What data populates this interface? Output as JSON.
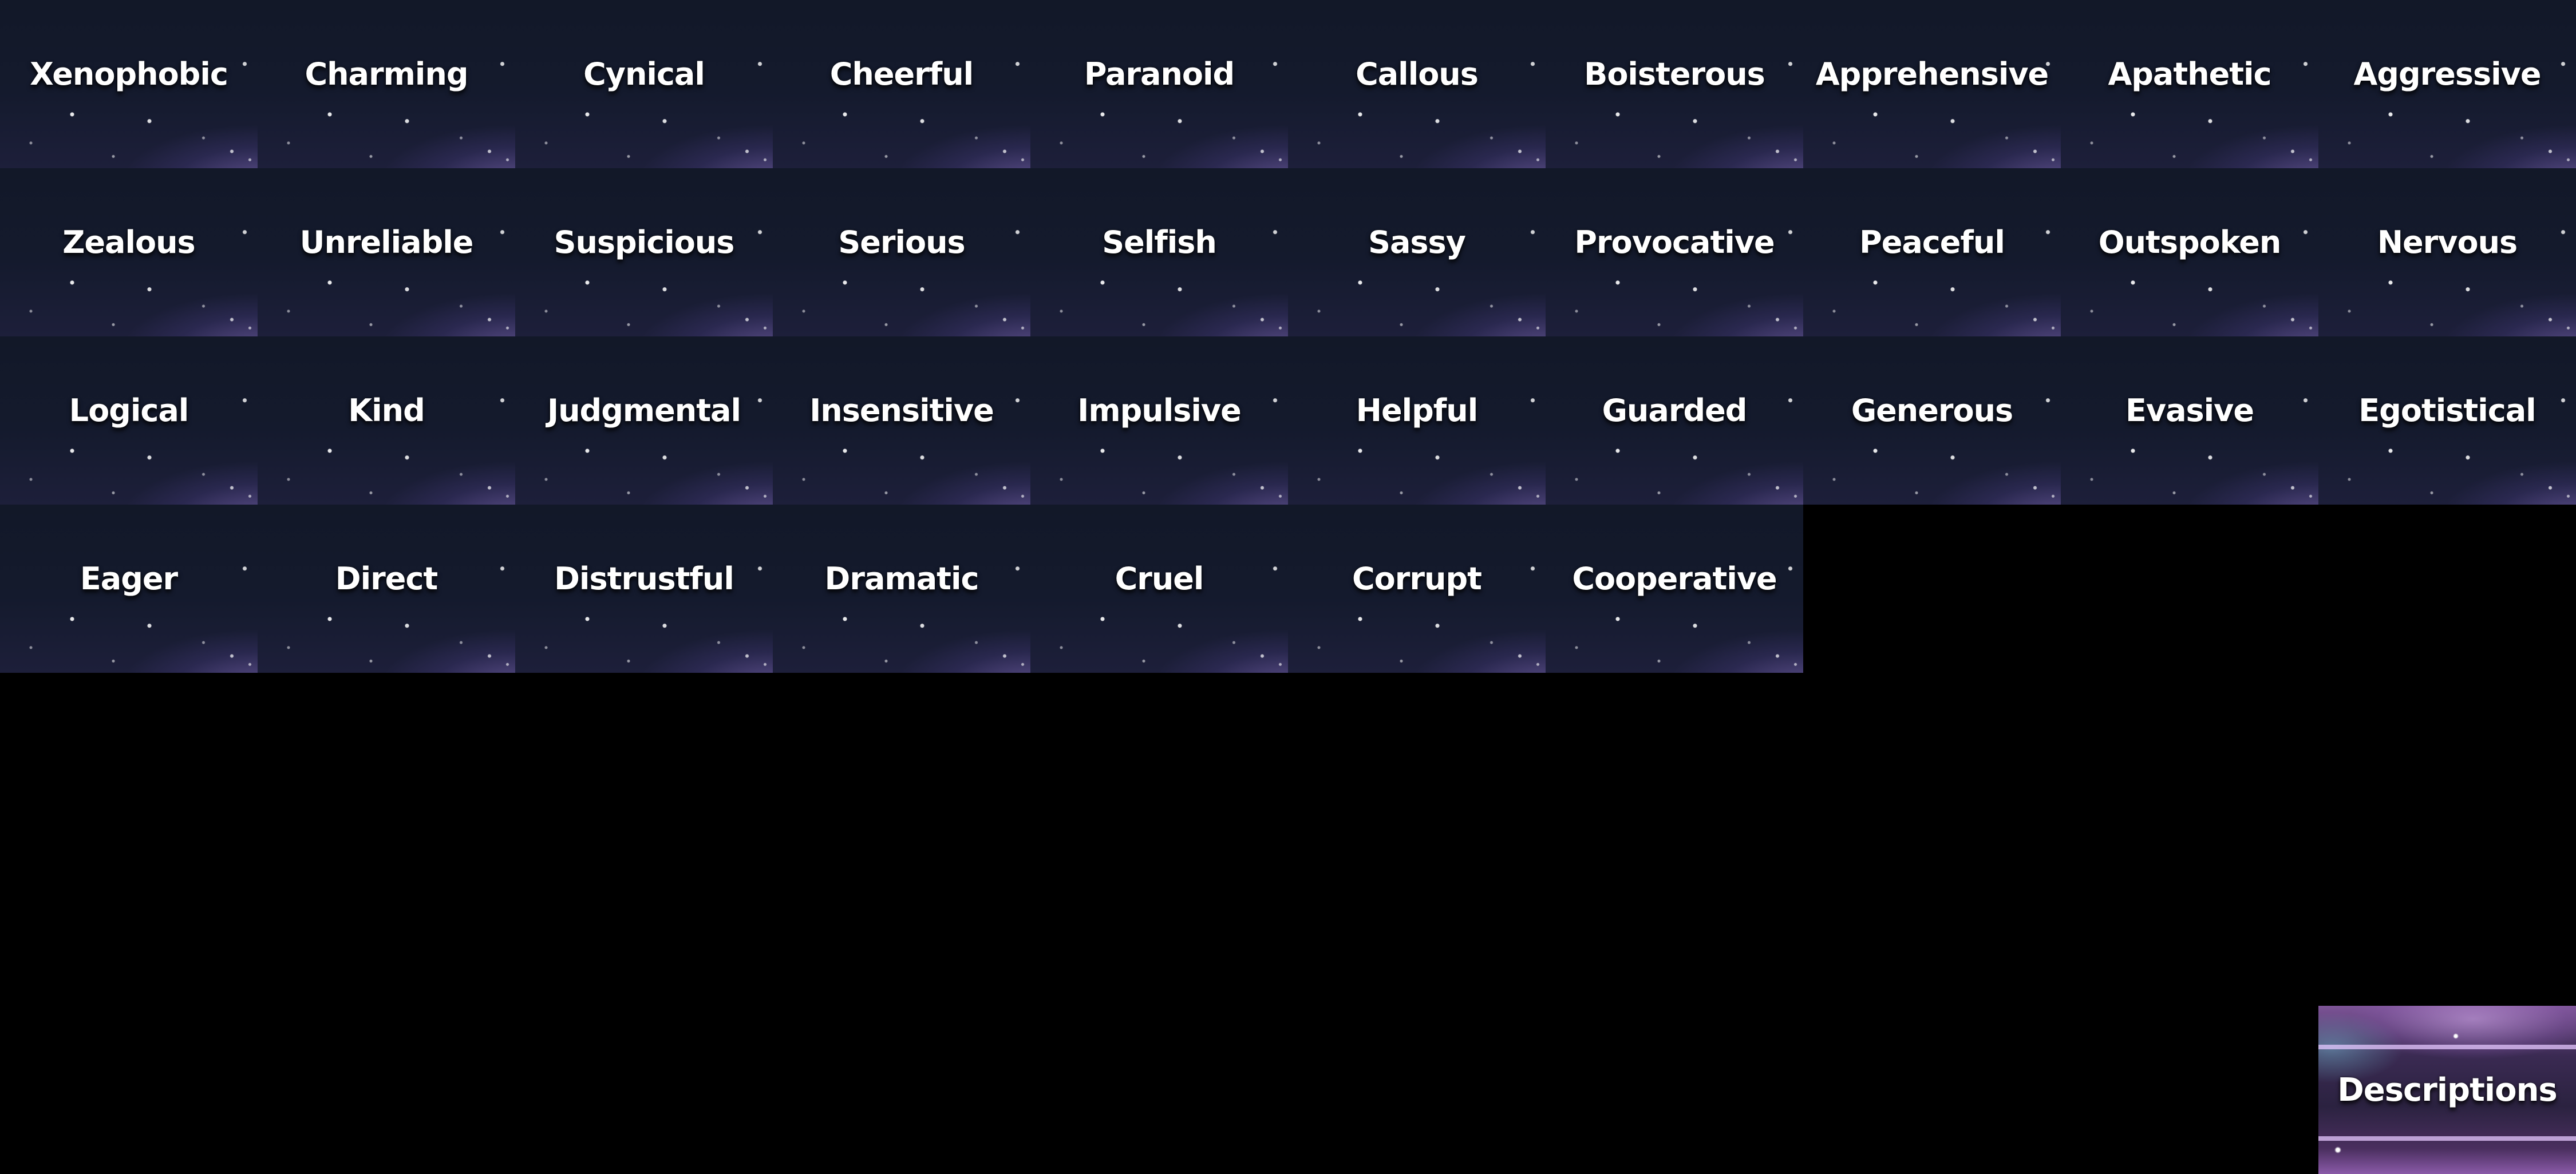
{
  "traits": [
    "Xenophobic",
    "Charming",
    "Cynical",
    "Cheerful",
    "Paranoid",
    "Callous",
    "Boisterous",
    "Apprehensive",
    "Apathetic",
    "Aggressive",
    "Zealous",
    "Unreliable",
    "Suspicious",
    "Serious",
    "Selfish",
    "Sassy",
    "Provocative",
    "Peaceful",
    "Outspoken",
    "Nervous",
    "Logical",
    "Kind",
    "Judgmental",
    "Insensitive",
    "Impulsive",
    "Helpful",
    "Guarded",
    "Generous",
    "Evasive",
    "Egotistical",
    "Eager",
    "Direct",
    "Distrustful",
    "Dramatic",
    "Cruel",
    "Corrupt",
    "Cooperative"
  ],
  "descriptions_button": {
    "label": "Descriptions"
  },
  "colors": {
    "background": "#000000",
    "tile_base": "#131a2b",
    "tile_glow": "#8c73c8",
    "label_text": "#ffffff",
    "descriptions_accent": "#8a5aa8"
  }
}
